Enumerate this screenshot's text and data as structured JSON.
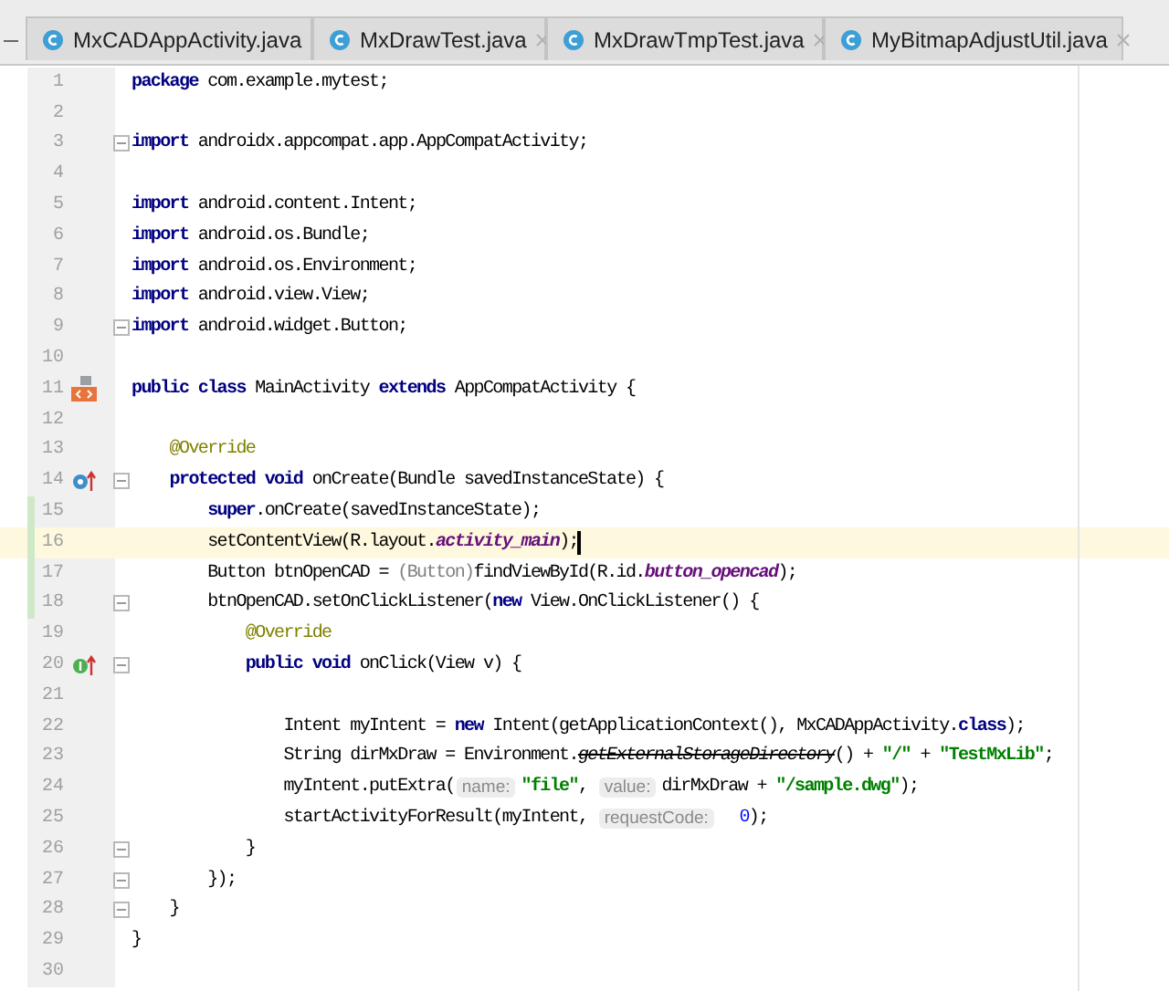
{
  "tabs": [
    {
      "label": "MxCADAppActivity.java"
    },
    {
      "label": "MxDrawTest.java"
    },
    {
      "label": "MxDrawTmpTest.java"
    },
    {
      "label": "MyBitmapAdjustUtil.java"
    }
  ],
  "lines": [
    {
      "n": "1",
      "fold": false,
      "changed": false,
      "current": false,
      "tokens": [
        {
          "kind": "kw",
          "text": "package"
        },
        {
          "kind": "plain",
          "text": " com.example.mytest;"
        }
      ]
    },
    {
      "n": "2",
      "fold": false,
      "changed": false,
      "current": false
    },
    {
      "n": "3",
      "fold": true,
      "changed": false,
      "current": false,
      "tokens": [
        {
          "kind": "kw",
          "text": "import"
        },
        {
          "kind": "plain",
          "text": " androidx.appcompat.app.AppCompatActivity;"
        }
      ]
    },
    {
      "n": "4",
      "fold": false,
      "changed": false,
      "current": false
    },
    {
      "n": "5",
      "fold": false,
      "changed": false,
      "current": false,
      "tokens": [
        {
          "kind": "kw",
          "text": "import"
        },
        {
          "kind": "plain",
          "text": " android.content.Intent;"
        }
      ]
    },
    {
      "n": "6",
      "fold": false,
      "changed": false,
      "current": false,
      "tokens": [
        {
          "kind": "kw",
          "text": "import"
        },
        {
          "kind": "plain",
          "text": " android.os.Bundle;"
        }
      ]
    },
    {
      "n": "7",
      "fold": false,
      "changed": false,
      "current": false,
      "tokens": [
        {
          "kind": "kw",
          "text": "import"
        },
        {
          "kind": "plain",
          "text": " android.os.Environment;"
        }
      ]
    },
    {
      "n": "8",
      "fold": false,
      "changed": false,
      "current": false,
      "tokens": [
        {
          "kind": "kw",
          "text": "import"
        },
        {
          "kind": "plain",
          "text": " android.view.View;"
        }
      ]
    },
    {
      "n": "9",
      "fold": true,
      "changed": false,
      "current": false,
      "tokens": [
        {
          "kind": "kw",
          "text": "import"
        },
        {
          "kind": "plain",
          "text": " android.widget.Button;"
        }
      ]
    },
    {
      "n": "10",
      "fold": false,
      "changed": false,
      "current": false
    },
    {
      "n": "11",
      "fold": false,
      "changed": false,
      "current": false,
      "kind": "class",
      "tokens": [
        {
          "kind": "kw",
          "text": "public class"
        },
        {
          "kind": "plain",
          "text": " MainActivity "
        },
        {
          "kind": "kw",
          "text": "extends"
        },
        {
          "kind": "plain",
          "text": " AppCompatActivity {"
        }
      ]
    },
    {
      "n": "12",
      "fold": false,
      "changed": false,
      "current": false
    },
    {
      "n": "13",
      "fold": false,
      "changed": false,
      "current": false,
      "tokens": [
        {
          "kind": "ann",
          "text": "    @Override"
        }
      ]
    },
    {
      "n": "14",
      "fold": true,
      "changed": false,
      "current": false,
      "kind": "override",
      "tokens": [
        {
          "kind": "kw",
          "text": "    protected void"
        },
        {
          "kind": "plain",
          "text": " onCreate(Bundle savedInstanceState) {"
        }
      ]
    },
    {
      "n": "15",
      "fold": false,
      "changed": true,
      "current": false,
      "tokens": [
        {
          "kind": "kw",
          "text": "        super"
        },
        {
          "kind": "plain",
          "text": ".onCreate(savedInstanceState);"
        }
      ]
    },
    {
      "n": "16",
      "fold": false,
      "changed": true,
      "current": true,
      "tokens": [
        {
          "kind": "plain",
          "text": "        setContentView(R.layout."
        },
        {
          "kind": "field",
          "text": "activity_main"
        },
        {
          "kind": "plain",
          "text": ");"
        }
      ]
    },
    {
      "n": "17",
      "fold": false,
      "changed": true,
      "current": false,
      "tokens": [
        {
          "kind": "plain",
          "text": "        Button btnOpenCAD = "
        },
        {
          "kind": "cast",
          "text": "(Button)"
        },
        {
          "kind": "plain",
          "text": "findViewById(R.id."
        },
        {
          "kind": "field",
          "text": "button_opencad"
        },
        {
          "kind": "plain",
          "text": ");"
        }
      ]
    },
    {
      "n": "18",
      "fold": true,
      "changed": true,
      "current": false,
      "tokens": [
        {
          "kind": "plain",
          "text": "        btnOpenCAD.setOnClickListener("
        },
        {
          "kind": "kw",
          "text": "new"
        },
        {
          "kind": "plain",
          "text": " View.OnClickListener() {"
        }
      ]
    },
    {
      "n": "19",
      "fold": false,
      "changed": false,
      "current": false,
      "tokens": [
        {
          "kind": "ann",
          "text": "            @Override"
        }
      ]
    },
    {
      "n": "20",
      "fold": true,
      "changed": false,
      "current": false,
      "kind": "implement",
      "tokens": [
        {
          "kind": "kw",
          "text": "            public void"
        },
        {
          "kind": "plain",
          "text": " onClick(View v) {"
        }
      ]
    },
    {
      "n": "21",
      "fold": false,
      "changed": false,
      "current": false
    },
    {
      "n": "22",
      "fold": false,
      "changed": false,
      "current": false,
      "tokens": [
        {
          "kind": "plain",
          "text": "                Intent myIntent = "
        },
        {
          "kind": "kw",
          "text": "new"
        },
        {
          "kind": "plain",
          "text": " Intent(getApplicationContext(), MxCADAppActivity."
        },
        {
          "kind": "kw",
          "text": "class"
        },
        {
          "kind": "plain",
          "text": ");"
        }
      ]
    },
    {
      "n": "23",
      "fold": false,
      "changed": false,
      "current": false,
      "tokens": [
        {
          "kind": "plain",
          "text": "                String dirMxDraw = Environment."
        },
        {
          "kind": "dep",
          "text": "getExternalStorageDirectory"
        },
        {
          "kind": "plain",
          "text": "() + "
        },
        {
          "kind": "str",
          "text": "\"/\""
        },
        {
          "kind": "plain",
          "text": " + "
        },
        {
          "kind": "str",
          "text": "\"TestMxLib\""
        },
        {
          "kind": "plain",
          "text": ";"
        }
      ]
    },
    {
      "n": "24",
      "fold": false,
      "changed": false,
      "current": false,
      "tokens": [
        {
          "kind": "plain",
          "text": "                myIntent.putExtra("
        },
        {
          "kind": "hint",
          "text": "name:"
        },
        {
          "kind": "str",
          "text": "\"file\""
        },
        {
          "kind": "plain",
          "text": ", "
        },
        {
          "kind": "hint",
          "text": "value:"
        },
        {
          "kind": "plain",
          "text": "dirMxDraw + "
        },
        {
          "kind": "str",
          "text": "\"/sample.dwg\""
        },
        {
          "kind": "plain",
          "text": ");"
        }
      ]
    },
    {
      "n": "25",
      "fold": false,
      "changed": false,
      "current": false,
      "tokens": [
        {
          "kind": "plain",
          "text": "                startActivityForResult(myIntent, "
        },
        {
          "kind": "hint",
          "text": "requestCode:"
        },
        {
          "kind": "num",
          "text": "0"
        },
        {
          "kind": "plain",
          "text": ");"
        }
      ]
    },
    {
      "n": "26",
      "fold": true,
      "changed": false,
      "current": false,
      "tokens": [
        {
          "kind": "plain",
          "text": "            }"
        }
      ]
    },
    {
      "n": "27",
      "fold": true,
      "changed": false,
      "current": false,
      "tokens": [
        {
          "kind": "plain",
          "text": "        });"
        }
      ]
    },
    {
      "n": "28",
      "fold": true,
      "changed": false,
      "current": false,
      "tokens": [
        {
          "kind": "plain",
          "text": "    }"
        }
      ]
    },
    {
      "n": "29",
      "fold": false,
      "changed": false,
      "current": false,
      "tokens": [
        {
          "kind": "plain",
          "text": "}"
        }
      ]
    },
    {
      "n": "30",
      "fold": false,
      "changed": false,
      "current": false
    }
  ]
}
